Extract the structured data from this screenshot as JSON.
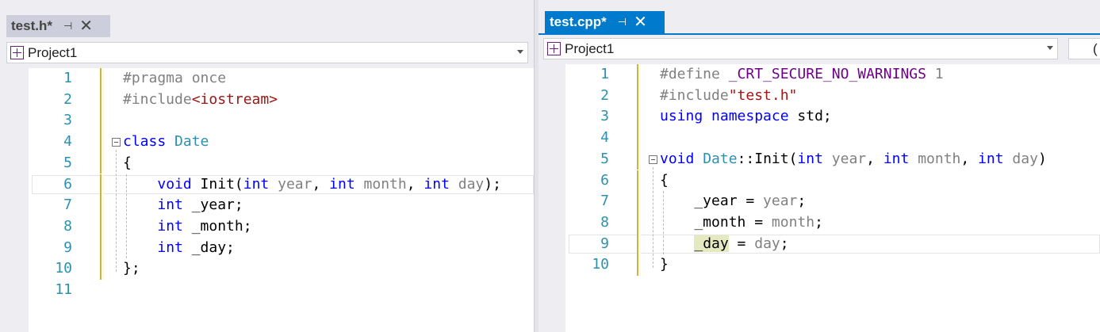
{
  "left": {
    "tab": {
      "title": "test.h*",
      "pin": "⊣",
      "close": "✕"
    },
    "navbar": {
      "project": "Project1"
    },
    "lines": [
      {
        "n": "1",
        "tokens": [
          [
            "pp",
            "#pragma once"
          ]
        ]
      },
      {
        "n": "2",
        "tokens": [
          [
            "pp",
            "#include"
          ],
          [
            "str",
            "<iostream>"
          ]
        ]
      },
      {
        "n": "3",
        "tokens": []
      },
      {
        "n": "4",
        "tokens": [
          [
            "kw",
            "class"
          ],
          [
            "tx",
            " "
          ],
          [
            "ty",
            "Date"
          ]
        ]
      },
      {
        "n": "5",
        "tokens": [
          [
            "tx",
            "{"
          ]
        ]
      },
      {
        "n": "6",
        "tokens": [
          [
            "tx",
            "    "
          ],
          [
            "kw",
            "void"
          ],
          [
            "tx",
            " Init("
          ],
          [
            "kw",
            "int"
          ],
          [
            "tx",
            " "
          ],
          [
            "prm",
            "year"
          ],
          [
            "tx",
            ", "
          ],
          [
            "kw",
            "int"
          ],
          [
            "tx",
            " "
          ],
          [
            "prm",
            "month"
          ],
          [
            "tx",
            ", "
          ],
          [
            "kw",
            "int"
          ],
          [
            "tx",
            " "
          ],
          [
            "prm",
            "day"
          ],
          [
            "tx",
            ");"
          ]
        ]
      },
      {
        "n": "7",
        "tokens": [
          [
            "tx",
            "    "
          ],
          [
            "kw",
            "int"
          ],
          [
            "tx",
            " _year;"
          ]
        ]
      },
      {
        "n": "8",
        "tokens": [
          [
            "tx",
            "    "
          ],
          [
            "kw",
            "int"
          ],
          [
            "tx",
            " _month;"
          ]
        ]
      },
      {
        "n": "9",
        "tokens": [
          [
            "tx",
            "    "
          ],
          [
            "kw",
            "int"
          ],
          [
            "tx",
            " _day;"
          ]
        ]
      },
      {
        "n": "10",
        "tokens": [
          [
            "tx",
            "};"
          ]
        ]
      },
      {
        "n": "11",
        "tokens": []
      }
    ]
  },
  "right": {
    "tab": {
      "title": "test.cpp*",
      "pin": "⊣",
      "close": "✕"
    },
    "navbar": {
      "project": "Project1",
      "scope": "("
    },
    "lines": [
      {
        "n": "1",
        "tokens": [
          [
            "pp",
            "#define "
          ],
          [
            "mac",
            "_CRT_SECURE_NO_WARNINGS"
          ],
          [
            "pp",
            " 1"
          ]
        ]
      },
      {
        "n": "2",
        "tokens": [
          [
            "pp",
            "#include"
          ],
          [
            "str",
            "\"test.h\""
          ]
        ]
      },
      {
        "n": "3",
        "tokens": [
          [
            "kw",
            "using"
          ],
          [
            "tx",
            " "
          ],
          [
            "kw",
            "namespace"
          ],
          [
            "tx",
            " std;"
          ]
        ]
      },
      {
        "n": "4",
        "tokens": []
      },
      {
        "n": "5",
        "tokens": [
          [
            "kw",
            "void"
          ],
          [
            "tx",
            " "
          ],
          [
            "ty",
            "Date"
          ],
          [
            "tx",
            "::Init("
          ],
          [
            "kw",
            "int"
          ],
          [
            "tx",
            " "
          ],
          [
            "prm",
            "year"
          ],
          [
            "tx",
            ", "
          ],
          [
            "kw",
            "int"
          ],
          [
            "tx",
            " "
          ],
          [
            "prm",
            "month"
          ],
          [
            "tx",
            ", "
          ],
          [
            "kw",
            "int"
          ],
          [
            "tx",
            " "
          ],
          [
            "prm",
            "day"
          ],
          [
            "tx",
            ")"
          ]
        ]
      },
      {
        "n": "6",
        "tokens": [
          [
            "tx",
            "{"
          ]
        ]
      },
      {
        "n": "7",
        "tokens": [
          [
            "tx",
            "    _year = "
          ],
          [
            "prm",
            "year"
          ],
          [
            "tx",
            ";"
          ]
        ]
      },
      {
        "n": "8",
        "tokens": [
          [
            "tx",
            "    _month = "
          ],
          [
            "prm",
            "month"
          ],
          [
            "tx",
            ";"
          ]
        ]
      },
      {
        "n": "9",
        "tokens": [
          [
            "tx",
            "    "
          ],
          [
            "hl",
            "_day"
          ],
          [
            "tx",
            " = "
          ],
          [
            "prm",
            "day"
          ],
          [
            "tx",
            ";"
          ]
        ]
      },
      {
        "n": "10",
        "tokens": [
          [
            "tx",
            "}"
          ]
        ]
      }
    ]
  },
  "colors": {
    "accent": "#007acc",
    "keyword": "#0000ff",
    "type": "#2b91af",
    "string": "#a31515",
    "macro": "#6f008a"
  }
}
